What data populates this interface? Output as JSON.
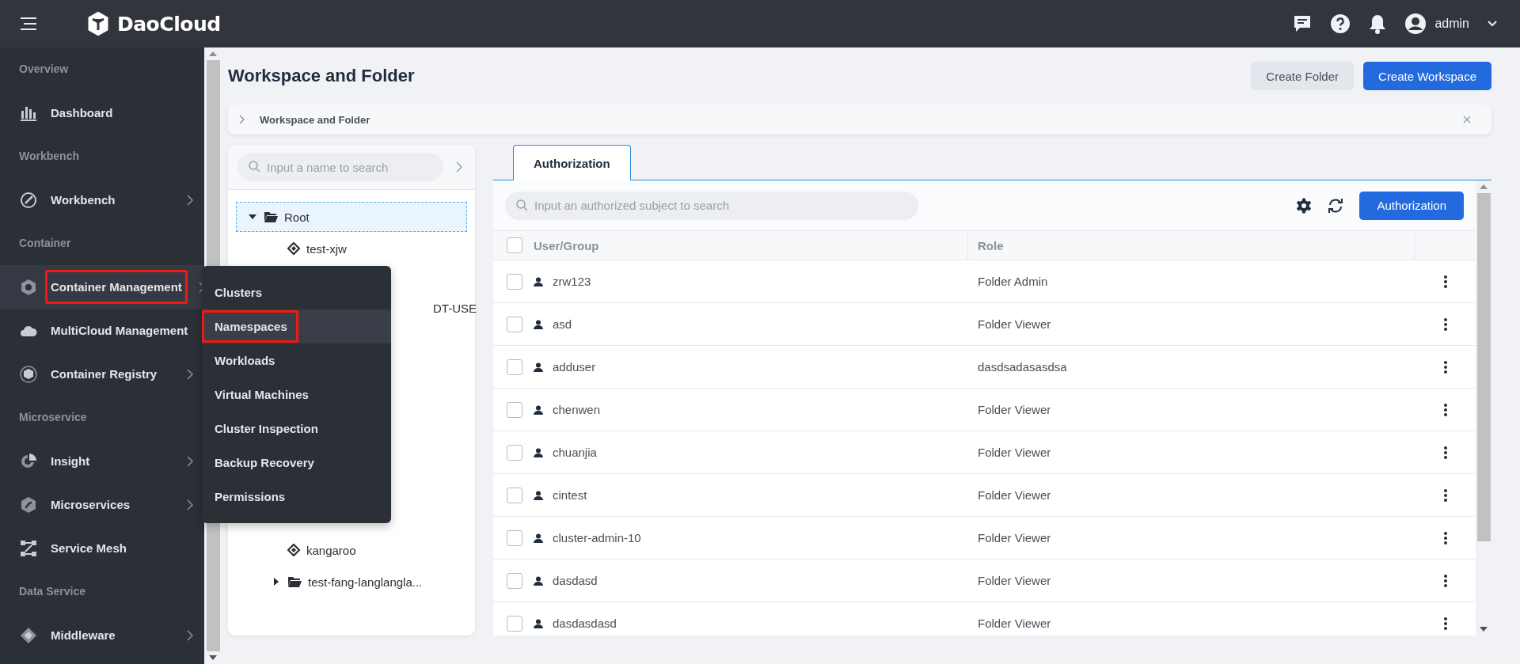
{
  "topbar": {
    "brand": "DaoCloud",
    "user": "admin"
  },
  "sidebar": {
    "groups": [
      {
        "label": "Overview",
        "items": [
          {
            "label": "Dashboard",
            "kind": "chart",
            "has_submenu": false,
            "selected": false,
            "annotated": false
          }
        ]
      },
      {
        "label": "Workbench",
        "items": [
          {
            "label": "Workbench",
            "kind": "pen",
            "has_submenu": true,
            "selected": false,
            "annotated": false
          }
        ]
      },
      {
        "label": "Container",
        "items": [
          {
            "label": "Container Management",
            "kind": "hex",
            "has_submenu": true,
            "selected": true,
            "annotated": true
          },
          {
            "label": "MultiCloud Management",
            "kind": "cloud",
            "has_submenu": false,
            "selected": false,
            "annotated": false
          },
          {
            "label": "Container Registry",
            "kind": "cube",
            "has_submenu": true,
            "selected": false,
            "annotated": false
          }
        ]
      },
      {
        "label": "Microservice",
        "items": [
          {
            "label": "Insight",
            "kind": "pie",
            "has_submenu": true,
            "selected": false,
            "annotated": false
          },
          {
            "label": "Microservices",
            "kind": "shield",
            "has_submenu": true,
            "selected": false,
            "annotated": false
          },
          {
            "label": "Service Mesh",
            "kind": "mesh",
            "has_submenu": false,
            "selected": false,
            "annotated": false
          }
        ]
      },
      {
        "label": "Data Service",
        "items": [
          {
            "label": "Middleware",
            "kind": "puzzle",
            "has_submenu": true,
            "selected": false,
            "annotated": false
          }
        ]
      }
    ]
  },
  "flyout": {
    "items": [
      {
        "label": "Clusters",
        "selected": false,
        "annotated": false
      },
      {
        "label": "Namespaces",
        "selected": true,
        "annotated": true
      },
      {
        "label": "Workloads",
        "selected": false,
        "annotated": false
      },
      {
        "label": "Virtual Machines",
        "selected": false,
        "annotated": false
      },
      {
        "label": "Cluster Inspection",
        "selected": false,
        "annotated": false
      },
      {
        "label": "Backup Recovery",
        "selected": false,
        "annotated": false
      },
      {
        "label": "Permissions",
        "selected": false,
        "annotated": false
      }
    ]
  },
  "page": {
    "title": "Workspace and Folder",
    "buttons": [
      {
        "label": "Create Folder",
        "kind": "secondary"
      },
      {
        "label": "Create Workspace",
        "kind": "primary"
      }
    ]
  },
  "breadcrumb": {
    "label": "Workspace and Folder"
  },
  "tree": {
    "search_placeholder": "Input a name to search",
    "nodes": [
      {
        "label": "Root",
        "kind": "folder",
        "expanded": true,
        "selected": true,
        "children": [
          {
            "label": "test-xjw",
            "kind": "workspace",
            "selected": false
          },
          {
            "label": "DT-USE",
            "kind": "clipped",
            "selected": false
          },
          {
            "label": "kangaroo",
            "kind": "workspace",
            "selected": false
          },
          {
            "label": "test-fang-langlangla...",
            "kind": "folder",
            "expanded": false,
            "selected": false
          }
        ]
      }
    ]
  },
  "tabs": [
    {
      "label": "Authorization",
      "selected": true
    }
  ],
  "toolbar": {
    "search_placeholder": "Input an authorized subject to search",
    "button": "Authorization"
  },
  "table": {
    "all_checked": false,
    "columns": [
      "User/Group",
      "Role"
    ],
    "rows": [
      {
        "name": "zrw123",
        "role": "Folder Admin",
        "checked": false
      },
      {
        "name": "asd",
        "role": "Folder Viewer",
        "checked": false
      },
      {
        "name": "adduser",
        "role": "dasdsadasasdsa",
        "checked": false
      },
      {
        "name": "chenwen",
        "role": "Folder Viewer",
        "checked": false
      },
      {
        "name": "chuanjia",
        "role": "Folder Viewer",
        "checked": false
      },
      {
        "name": "cintest",
        "role": "Folder Viewer",
        "checked": false
      },
      {
        "name": "cluster-admin-10",
        "role": "Folder Viewer",
        "checked": false
      },
      {
        "name": "dasdasd",
        "role": "Folder Viewer",
        "checked": false
      },
      {
        "name": "dasdasdasd",
        "role": "Folder Viewer",
        "checked": false
      }
    ]
  }
}
